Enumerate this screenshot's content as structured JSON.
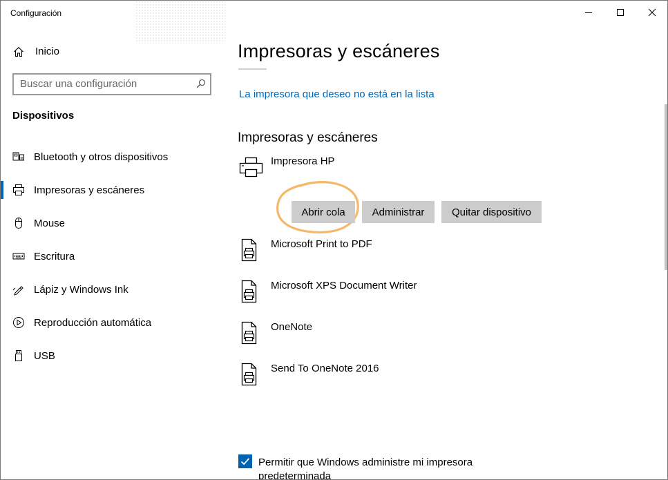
{
  "window": {
    "title": "Configuración"
  },
  "sidebar": {
    "home_label": "Inicio",
    "search_placeholder": "Buscar una configuración",
    "section_title": "Dispositivos",
    "items": [
      {
        "label": "Bluetooth y otros dispositivos",
        "icon": "bluetooth-devices-icon"
      },
      {
        "label": "Impresoras y escáneres",
        "icon": "printer-icon",
        "active": true
      },
      {
        "label": "Mouse",
        "icon": "mouse-icon"
      },
      {
        "label": "Escritura",
        "icon": "keyboard-icon"
      },
      {
        "label": "Lápiz y Windows Ink",
        "icon": "pen-icon"
      },
      {
        "label": "Reproducción automática",
        "icon": "autoplay-icon"
      },
      {
        "label": "USB",
        "icon": "usb-icon"
      }
    ]
  },
  "main": {
    "title": "Impresoras y escáneres",
    "missing_printer_link": "La impresora que deseo no está en la lista",
    "section_title": "Impresoras y escáneres",
    "printers": [
      {
        "name": "Impresora HP",
        "icon": "printer-icon"
      },
      {
        "name": "Microsoft Print to PDF",
        "icon": "document-printer-icon"
      },
      {
        "name": "Microsoft XPS Document Writer",
        "icon": "document-printer-icon"
      },
      {
        "name": "OneNote",
        "icon": "document-printer-icon"
      },
      {
        "name": "Send To OneNote 2016",
        "icon": "document-printer-icon"
      }
    ],
    "buttons": {
      "open_queue": "Abrir cola",
      "manage": "Administrar",
      "remove": "Quitar dispositivo"
    },
    "default_printer_checkbox": {
      "label": "Permitir que Windows administre mi impresora predeterminada",
      "checked": true
    }
  },
  "colors": {
    "accent": "#0063b1",
    "link": "#0067b8",
    "button": "#cccccc",
    "annotation": "#f5b86a"
  }
}
